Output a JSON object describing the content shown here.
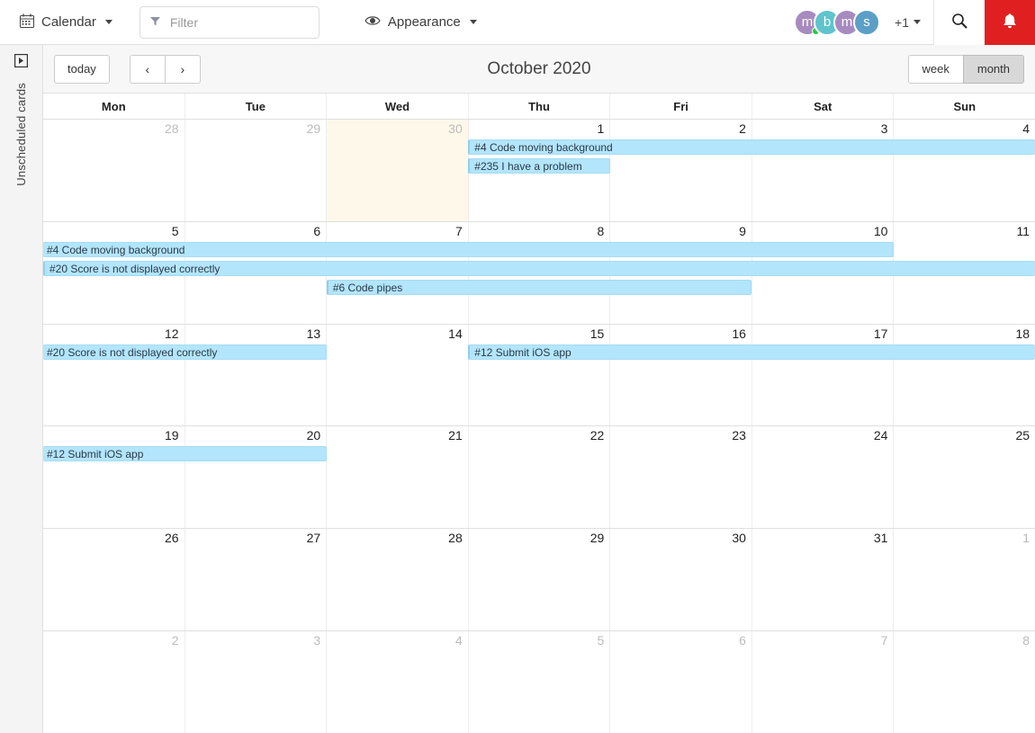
{
  "toolbar": {
    "calendar_label": "Calendar",
    "calendar_icon": "calendar-icon",
    "filter_placeholder": "Filter",
    "filter_value": "",
    "filter_icon": "funnel-icon",
    "appearance_label": "Appearance",
    "appearance_icon": "eye-icon",
    "avatars": [
      {
        "initial": "m",
        "color": "#a78bc0",
        "online": true
      },
      {
        "initial": "b",
        "color": "#5fc4cc",
        "online": false
      },
      {
        "initial": "m",
        "color": "#a78bc0",
        "online": false
      },
      {
        "initial": "s",
        "color": "#5b9fc6",
        "online": false
      }
    ],
    "more_label": "+1",
    "search_icon": "search-icon",
    "bell_icon": "bell-icon",
    "bell_color": "#e02020"
  },
  "sidebar": {
    "toggle_icon": "panel-expand-icon",
    "label": "Unscheduled cards"
  },
  "calendar_header": {
    "today_label": "today",
    "prev_label": "‹",
    "next_label": "›",
    "title": "October 2020",
    "views": [
      {
        "label": "week",
        "active": false
      },
      {
        "label": "month",
        "active": true
      }
    ]
  },
  "weekdays": [
    "Mon",
    "Tue",
    "Wed",
    "Thu",
    "Fri",
    "Sat",
    "Sun"
  ],
  "weeks": [
    {
      "days": [
        {
          "num": "28",
          "other_month": true,
          "today": false
        },
        {
          "num": "29",
          "other_month": true,
          "today": false
        },
        {
          "num": "30",
          "other_month": true,
          "today": true
        },
        {
          "num": "1",
          "other_month": false,
          "today": false
        },
        {
          "num": "2",
          "other_month": false,
          "today": false
        },
        {
          "num": "3",
          "other_month": false,
          "today": false
        },
        {
          "num": "4",
          "other_month": false,
          "today": false
        }
      ],
      "events": [
        {
          "label": "#4 Code moving background",
          "start": 3,
          "span": 4,
          "row": 0,
          "starts": true,
          "ends": false
        },
        {
          "label": "#235 I have a problem",
          "start": 3,
          "span": 1,
          "row": 1,
          "starts": true,
          "ends": true
        }
      ]
    },
    {
      "days": [
        {
          "num": "5",
          "other_month": false,
          "today": false
        },
        {
          "num": "6",
          "other_month": false,
          "today": false
        },
        {
          "num": "7",
          "other_month": false,
          "today": false
        },
        {
          "num": "8",
          "other_month": false,
          "today": false
        },
        {
          "num": "9",
          "other_month": false,
          "today": false
        },
        {
          "num": "10",
          "other_month": false,
          "today": false
        },
        {
          "num": "11",
          "other_month": false,
          "today": false
        }
      ],
      "events": [
        {
          "label": "#4 Code moving background",
          "start": 0,
          "span": 6,
          "row": 0,
          "starts": false,
          "ends": true
        },
        {
          "label": "#20 Score is not displayed correctly",
          "start": 0,
          "span": 7,
          "row": 1,
          "starts": true,
          "ends": false
        },
        {
          "label": "#6 Code pipes",
          "start": 2,
          "span": 3,
          "row": 2,
          "starts": true,
          "ends": true
        }
      ]
    },
    {
      "days": [
        {
          "num": "12",
          "other_month": false,
          "today": false
        },
        {
          "num": "13",
          "other_month": false,
          "today": false
        },
        {
          "num": "14",
          "other_month": false,
          "today": false
        },
        {
          "num": "15",
          "other_month": false,
          "today": false
        },
        {
          "num": "16",
          "other_month": false,
          "today": false
        },
        {
          "num": "17",
          "other_month": false,
          "today": false
        },
        {
          "num": "18",
          "other_month": false,
          "today": false
        }
      ],
      "events": [
        {
          "label": "#20 Score is not displayed correctly",
          "start": 0,
          "span": 2,
          "row": 0,
          "starts": false,
          "ends": true
        },
        {
          "label": "#12 Submit iOS app",
          "start": 3,
          "span": 4,
          "row": 0,
          "starts": true,
          "ends": false
        }
      ]
    },
    {
      "days": [
        {
          "num": "19",
          "other_month": false,
          "today": false
        },
        {
          "num": "20",
          "other_month": false,
          "today": false
        },
        {
          "num": "21",
          "other_month": false,
          "today": false
        },
        {
          "num": "22",
          "other_month": false,
          "today": false
        },
        {
          "num": "23",
          "other_month": false,
          "today": false
        },
        {
          "num": "24",
          "other_month": false,
          "today": false
        },
        {
          "num": "25",
          "other_month": false,
          "today": false
        }
      ],
      "events": [
        {
          "label": "#12 Submit iOS app",
          "start": 0,
          "span": 2,
          "row": 0,
          "starts": false,
          "ends": true
        }
      ]
    },
    {
      "days": [
        {
          "num": "26",
          "other_month": false,
          "today": false
        },
        {
          "num": "27",
          "other_month": false,
          "today": false
        },
        {
          "num": "28",
          "other_month": false,
          "today": false
        },
        {
          "num": "29",
          "other_month": false,
          "today": false
        },
        {
          "num": "30",
          "other_month": false,
          "today": false
        },
        {
          "num": "31",
          "other_month": false,
          "today": false
        },
        {
          "num": "1",
          "other_month": true,
          "today": false
        }
      ],
      "events": []
    },
    {
      "days": [
        {
          "num": "2",
          "other_month": true,
          "today": false
        },
        {
          "num": "3",
          "other_month": true,
          "today": false
        },
        {
          "num": "4",
          "other_month": true,
          "today": false
        },
        {
          "num": "5",
          "other_month": true,
          "today": false
        },
        {
          "num": "6",
          "other_month": true,
          "today": false
        },
        {
          "num": "7",
          "other_month": true,
          "today": false
        },
        {
          "num": "8",
          "other_month": true,
          "today": false
        }
      ],
      "events": []
    }
  ]
}
